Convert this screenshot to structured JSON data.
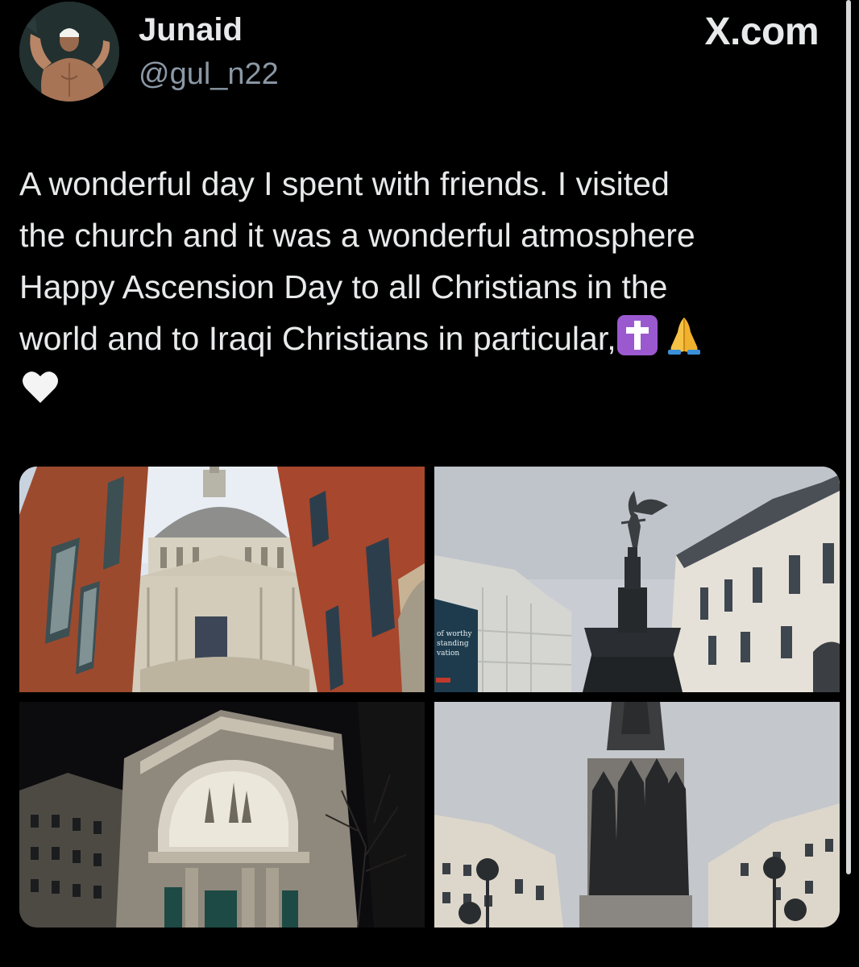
{
  "author": {
    "display_name": "Junaid",
    "handle": "@gul_n22",
    "avatar_icon": "profile-photo-avatar"
  },
  "brand": {
    "label": "X.com"
  },
  "tweet": {
    "lines": [
      "A wonderful day I spent with friends. I visited",
      "the church and it was a wonderful atmosphere",
      "Happy Ascension Day to all Christians in the",
      "world and to Iraqi Christians in particular,"
    ],
    "emojis": [
      "latin-cross-emoji",
      "folded-hands-emoji",
      "white-heart-emoji"
    ]
  },
  "media": {
    "photos": [
      {
        "icon": "cathedral-dome-photo"
      },
      {
        "icon": "eros-statue-fountain-photo"
      },
      {
        "icon": "night-archway-building-photo"
      },
      {
        "icon": "guards-memorial-statue-photo"
      }
    ],
    "sign_lines": [
      "of worthy",
      "standing",
      "vation"
    ]
  },
  "colors": {
    "background": "#000000",
    "text": "#e7e9ea",
    "secondary_text": "#8b98a5",
    "cross_emoji_bg": "#9b59d0"
  }
}
